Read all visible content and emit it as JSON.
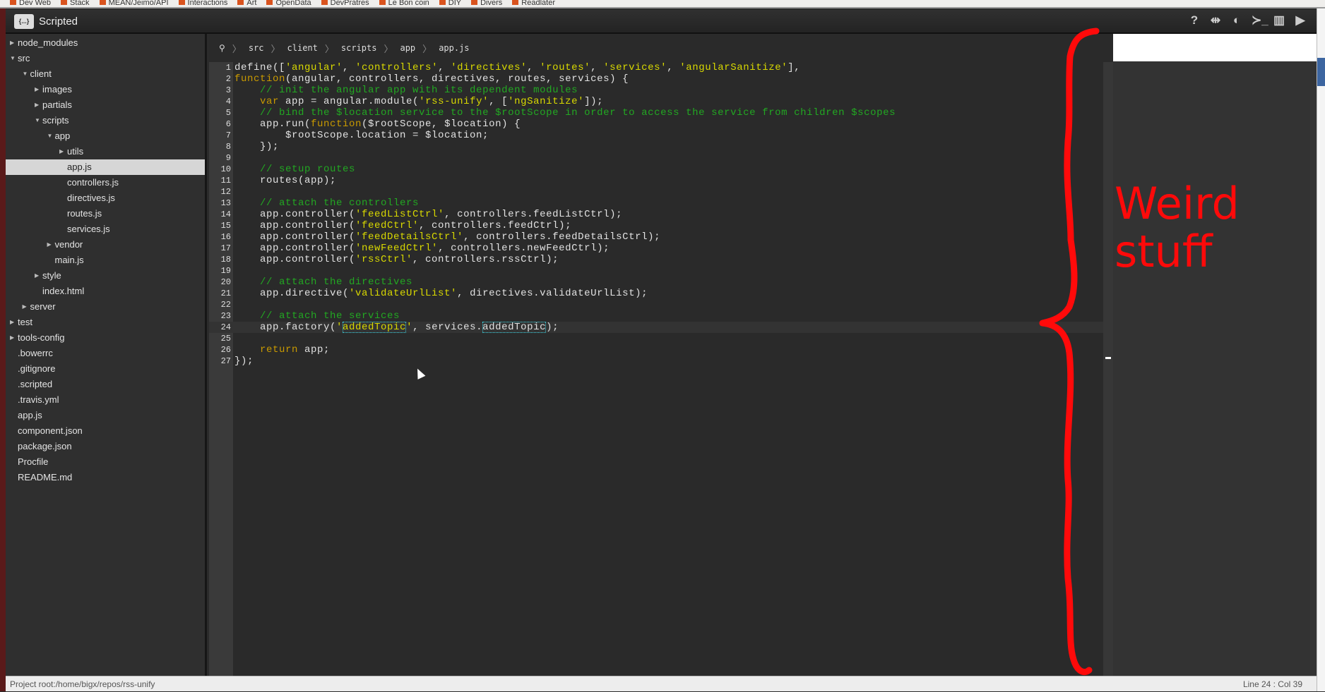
{
  "browser": {
    "bookmarks": [
      "Dev Web",
      "Stack",
      "MEAN/Jeimo/API",
      "Interactions",
      "Art",
      "OpenData",
      "DevPratres",
      "Le Bon coin",
      "DIY",
      "Divers",
      "Readlater"
    ]
  },
  "app": {
    "title": "Scripted",
    "logo_text": "{...}",
    "toolbar": [
      {
        "icon": "help-icon",
        "glyph": "?"
      },
      {
        "icon": "side-panel-toggle-icon",
        "glyph": "⇹"
      },
      {
        "icon": "theme-icon",
        "glyph": "◐"
      },
      {
        "icon": "console-icon",
        "glyph": "≻_"
      },
      {
        "icon": "layout-icon",
        "glyph": "▥"
      },
      {
        "icon": "run-icon",
        "glyph": "▶"
      }
    ]
  },
  "tree": [
    {
      "label": "node_modules",
      "depth": 0,
      "type": "folder",
      "open": false
    },
    {
      "label": "src",
      "depth": 0,
      "type": "folder",
      "open": true
    },
    {
      "label": "client",
      "depth": 1,
      "type": "folder",
      "open": true
    },
    {
      "label": "images",
      "depth": 2,
      "type": "folder",
      "open": false
    },
    {
      "label": "partials",
      "depth": 2,
      "type": "folder",
      "open": false
    },
    {
      "label": "scripts",
      "depth": 2,
      "type": "folder",
      "open": true
    },
    {
      "label": "app",
      "depth": 3,
      "type": "folder",
      "open": true
    },
    {
      "label": "utils",
      "depth": 4,
      "type": "folder",
      "open": false
    },
    {
      "label": "app.js",
      "depth": 4,
      "type": "file",
      "selected": true
    },
    {
      "label": "controllers.js",
      "depth": 4,
      "type": "file"
    },
    {
      "label": "directives.js",
      "depth": 4,
      "type": "file"
    },
    {
      "label": "routes.js",
      "depth": 4,
      "type": "file"
    },
    {
      "label": "services.js",
      "depth": 4,
      "type": "file"
    },
    {
      "label": "vendor",
      "depth": 3,
      "type": "folder",
      "open": false
    },
    {
      "label": "main.js",
      "depth": 3,
      "type": "file"
    },
    {
      "label": "style",
      "depth": 2,
      "type": "folder",
      "open": false
    },
    {
      "label": "index.html",
      "depth": 2,
      "type": "file"
    },
    {
      "label": "server",
      "depth": 1,
      "type": "folder",
      "open": false
    },
    {
      "label": "test",
      "depth": 0,
      "type": "folder",
      "open": false
    },
    {
      "label": "tools-config",
      "depth": 0,
      "type": "folder",
      "open": false
    },
    {
      "label": ".bowerrc",
      "depth": 0,
      "type": "file"
    },
    {
      "label": ".gitignore",
      "depth": 0,
      "type": "file"
    },
    {
      "label": ".scripted",
      "depth": 0,
      "type": "file"
    },
    {
      "label": ".travis.yml",
      "depth": 0,
      "type": "file"
    },
    {
      "label": "app.js",
      "depth": 0,
      "type": "file"
    },
    {
      "label": "component.json",
      "depth": 0,
      "type": "file"
    },
    {
      "label": "package.json",
      "depth": 0,
      "type": "file"
    },
    {
      "label": "Procfile",
      "depth": 0,
      "type": "file"
    },
    {
      "label": "README.md",
      "depth": 0,
      "type": "file"
    }
  ],
  "breadcrumb": [
    "src",
    "client",
    "scripts",
    "app",
    "app.js"
  ],
  "editor": {
    "current_line": 24,
    "lines": [
      [
        [
          "p",
          "define(["
        ],
        [
          "str",
          "'angular'"
        ],
        [
          "p",
          ", "
        ],
        [
          "str",
          "'controllers'"
        ],
        [
          "p",
          ", "
        ],
        [
          "str",
          "'directives'"
        ],
        [
          "p",
          ", "
        ],
        [
          "str",
          "'routes'"
        ],
        [
          "p",
          ", "
        ],
        [
          "str",
          "'services'"
        ],
        [
          "p",
          ", "
        ],
        [
          "str",
          "'angularSanitize'"
        ],
        [
          "p",
          "],"
        ]
      ],
      [
        [
          "kw",
          "function"
        ],
        [
          "p",
          "(angular, controllers, directives, routes, services) {"
        ]
      ],
      [
        [
          "p",
          "    "
        ],
        [
          "com",
          "// init the angular app with its dependent modules"
        ]
      ],
      [
        [
          "p",
          "    "
        ],
        [
          "kw",
          "var"
        ],
        [
          "p",
          " app = angular.module("
        ],
        [
          "str",
          "'rss-unify'"
        ],
        [
          "p",
          ", ["
        ],
        [
          "str",
          "'ngSanitize'"
        ],
        [
          "p",
          "]);"
        ]
      ],
      [
        [
          "p",
          "    "
        ],
        [
          "com",
          "// bind the $location service to the $rootScope in order to access the service from children $scopes"
        ]
      ],
      [
        [
          "p",
          "    app.run("
        ],
        [
          "kw",
          "function"
        ],
        [
          "p",
          "($rootScope, $location) {"
        ]
      ],
      [
        [
          "p",
          "        $rootScope.location = $location;"
        ]
      ],
      [
        [
          "p",
          "    });"
        ]
      ],
      [],
      [
        [
          "p",
          "    "
        ],
        [
          "com",
          "// setup routes"
        ]
      ],
      [
        [
          "p",
          "    routes(app);"
        ]
      ],
      [],
      [
        [
          "p",
          "    "
        ],
        [
          "com",
          "// attach the controllers"
        ]
      ],
      [
        [
          "p",
          "    app.controller("
        ],
        [
          "str",
          "'feedListCtrl'"
        ],
        [
          "p",
          ", controllers.feedListCtrl);"
        ]
      ],
      [
        [
          "p",
          "    app.controller("
        ],
        [
          "str",
          "'feedCtrl'"
        ],
        [
          "p",
          ", controllers.feedCtrl);"
        ]
      ],
      [
        [
          "p",
          "    app.controller("
        ],
        [
          "str",
          "'feedDetailsCtrl'"
        ],
        [
          "p",
          ", controllers.feedDetailsCtrl);"
        ]
      ],
      [
        [
          "p",
          "    app.controller("
        ],
        [
          "str",
          "'newFeedCtrl'"
        ],
        [
          "p",
          ", controllers.newFeedCtrl);"
        ]
      ],
      [
        [
          "p",
          "    app.controller("
        ],
        [
          "str",
          "'rssCtrl'"
        ],
        [
          "p",
          ", controllers.rssCtrl);"
        ]
      ],
      [],
      [
        [
          "p",
          "    "
        ],
        [
          "com",
          "// attach the directives"
        ]
      ],
      [
        [
          "p",
          "    app.directive("
        ],
        [
          "str",
          "'validateUrlList'"
        ],
        [
          "p",
          ", directives.validateUrlList);"
        ]
      ],
      [],
      [
        [
          "p",
          "    "
        ],
        [
          "com",
          "// attach the services"
        ]
      ],
      [
        [
          "p",
          "    app.factory("
        ],
        [
          "str",
          "'"
        ],
        [
          "strhl",
          "addedTopic"
        ],
        [
          "str",
          "'"
        ],
        [
          "p",
          ", services."
        ],
        [
          "phl",
          "addedTopic"
        ],
        [
          "p",
          ");"
        ]
      ],
      [],
      [
        [
          "p",
          "    "
        ],
        [
          "kw",
          "return"
        ],
        [
          "p",
          " app;"
        ]
      ],
      [
        [
          "p",
          "});"
        ]
      ]
    ]
  },
  "status": {
    "left": "Project root:/home/bigx/repos/rss-unify",
    "right": "Line 24 : Col 39"
  },
  "annotation": {
    "text_line1": "Weird",
    "text_line2": "stuff",
    "color": "#ff0a0a"
  },
  "colors": {
    "keyword": "#c99a00",
    "string": "#d9d900",
    "comment": "#22a822",
    "match_highlight": "#3cd7e6"
  }
}
